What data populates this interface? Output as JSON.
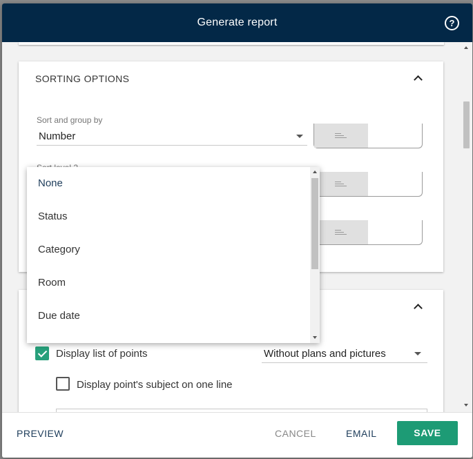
{
  "dialog": {
    "title": "Generate report",
    "help_icon": "help-circle-icon"
  },
  "sorting": {
    "title": "SORTING OPTIONS",
    "sort_and_group_by": {
      "label": "Sort and group by",
      "value": "Number"
    },
    "sort_level_2": {
      "label": "Sort level 2"
    }
  },
  "dropdown": {
    "options": [
      "None",
      "Status",
      "Category",
      "Room",
      "Due date"
    ],
    "selected": "None"
  },
  "display": {
    "display_list_label": "Display list of points",
    "display_list_checked": true,
    "plans_option": "Without plans and pictures",
    "subject_one_line_label": "Display point's subject on one line",
    "subject_one_line_checked": false
  },
  "footer": {
    "preview": "PREVIEW",
    "cancel": "CANCEL",
    "email": "EMAIL",
    "save": "SAVE"
  },
  "colors": {
    "header_bg": "#032847",
    "accent": "#1d9b75",
    "link": "#1d3c5a"
  }
}
